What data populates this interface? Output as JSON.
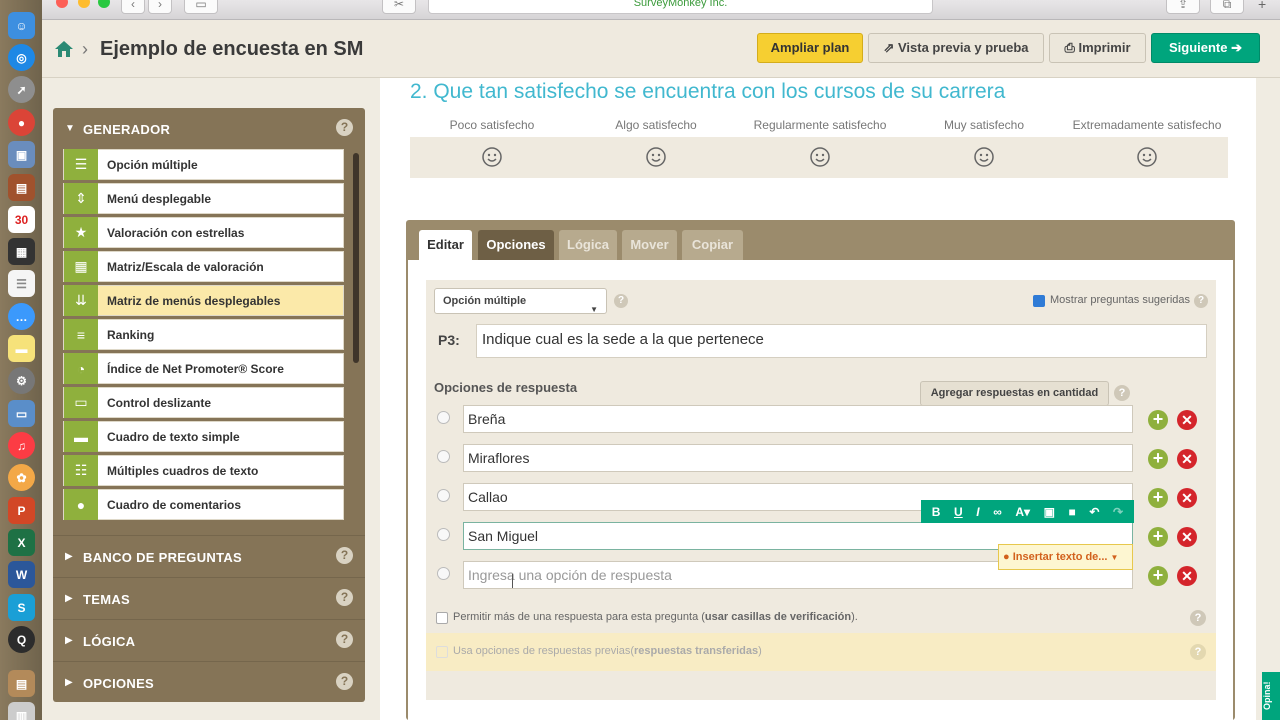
{
  "browser": {
    "url": "SurveyMonkey Inc."
  },
  "header": {
    "title": "Ejemplo de encuesta en SM",
    "upgrade": "Ampliar plan",
    "preview": "Vista previa y prueba",
    "print": "Imprimir",
    "next": "Siguiente"
  },
  "sidebar": {
    "builder_title": "GENERADOR",
    "help": "?",
    "tools": [
      {
        "label": "Opción múltiple",
        "icon": "list-icon"
      },
      {
        "label": "Menú desplegable",
        "icon": "dropdown-icon"
      },
      {
        "label": "Valoración con estrellas",
        "icon": "star-icon"
      },
      {
        "label": "Matriz/Escala de valoración",
        "icon": "grid-icon"
      },
      {
        "label": "Matriz de menús desplegables",
        "icon": "matrix-dropdown-icon"
      },
      {
        "label": "Ranking",
        "icon": "ranking-icon"
      },
      {
        "label": "Índice de Net Promoter® Score",
        "icon": "gauge-icon"
      },
      {
        "label": "Control deslizante",
        "icon": "slider-icon"
      },
      {
        "label": "Cuadro de texto simple",
        "icon": "textbox-icon"
      },
      {
        "label": "Múltiples cuadros de texto",
        "icon": "multi-textbox-icon"
      },
      {
        "label": "Cuadro de comentarios",
        "icon": "comment-icon"
      }
    ],
    "sections": [
      "BANCO DE PREGUNTAS",
      "TEMAS",
      "LÓGICA",
      "OPCIONES"
    ]
  },
  "question2": {
    "title": "2. Que tan satisfecho se encuentra con los cursos de su carrera",
    "scale": [
      "Poco satisfecho",
      "Algo satisfecho",
      "Regularmente satisfecho",
      "Muy satisfecho",
      "Extremadamente satisfecho"
    ]
  },
  "editor": {
    "tabs": [
      "Editar",
      "Opciones",
      "Lógica",
      "Mover",
      "Copiar"
    ],
    "question_type": "Opción múltiple",
    "show_suggested": "Mostrar preguntas sugeridas",
    "q_label": "P3:",
    "q_text": "Indique cual es la sede a la que pertenece",
    "answers_heading": "Opciones de respuesta",
    "bulk_button": "Agregar respuestas en cantidad",
    "answers": [
      "Breña",
      "Miraflores",
      "Callao",
      "San Miguel"
    ],
    "answer_placeholder": "Ingresa una opción de respuesta",
    "insert_text": "Insertar texto de...",
    "allow_multiple_pre": "Permitir más de una respuesta para esta pregunta (",
    "allow_multiple_bold": "usar casillas de verificación",
    "allow_multiple_post": ").",
    "carry_pre": "Usa opciones de respuestas previas(",
    "carry_bold": "respuestas transferidas",
    "carry_post": ")"
  },
  "feedback_tab": "Opina!"
}
